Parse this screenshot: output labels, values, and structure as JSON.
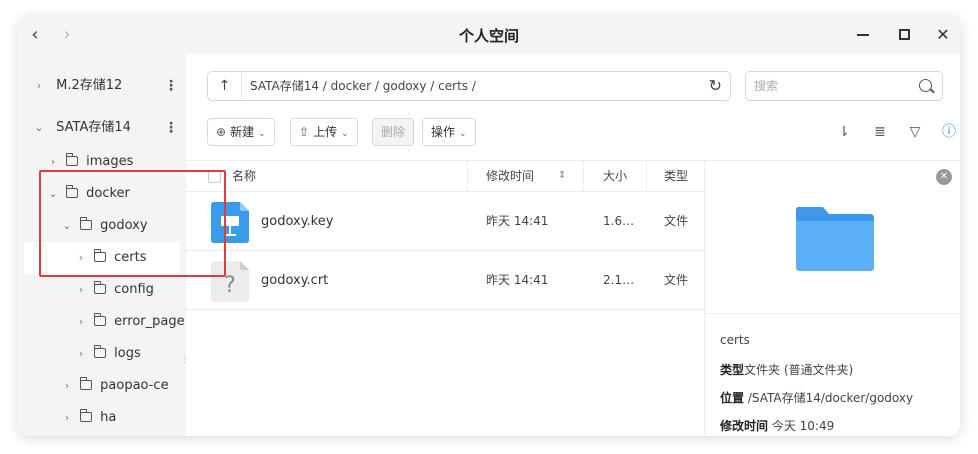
{
  "window": {
    "title": "个人空间",
    "back_icon": "chevron-left-icon",
    "forward_icon": "chevron-right-icon"
  },
  "sidebar": {
    "items": [
      {
        "label": "M.2存储12",
        "level": 0
      },
      {
        "label": "SATA存储14",
        "level": 0
      },
      {
        "label": "images",
        "level": 1
      },
      {
        "label": "docker",
        "level": 1
      },
      {
        "label": "godoxy",
        "level": 2
      },
      {
        "label": "certs",
        "level": 3
      },
      {
        "label": "config",
        "level": 3
      },
      {
        "label": "error_page",
        "level": 3
      },
      {
        "label": "logs",
        "level": 3
      },
      {
        "label": "paopao-ce",
        "level": 2
      },
      {
        "label": "ha",
        "level": 2
      }
    ]
  },
  "pathbar": {
    "path": "SATA存储14 / docker / godoxy / certs /"
  },
  "search": {
    "placeholder": "搜索"
  },
  "toolbar": {
    "new_label": "新建",
    "upload_label": "上传",
    "delete_label": "删除",
    "action_label": "操作"
  },
  "table": {
    "headers": {
      "name": "名称",
      "modified": "修改时间",
      "size": "大小",
      "type": "类型"
    },
    "rows": [
      {
        "name": "godoxy.key",
        "modified": "昨天 14:41",
        "size": "1.6…",
        "type": "文件",
        "icon": "keynote-file-icon"
      },
      {
        "name": "godoxy.crt",
        "modified": "昨天 14:41",
        "size": "2.1…",
        "type": "文件",
        "icon": "unknown-file-icon"
      }
    ]
  },
  "detail": {
    "name": "certs",
    "type_label": "类型",
    "type_value": "文件夹 (普通文件夹)",
    "location_label": "位置",
    "location_value": " /SATA存储14/docker/godoxy",
    "modified_label": "修改时间",
    "modified_value": " 今天 10:49"
  },
  "colors": {
    "accent": "#2f7cf6",
    "highlight_border": "#e23b3b",
    "folder_blue": "#4aa3f5"
  }
}
